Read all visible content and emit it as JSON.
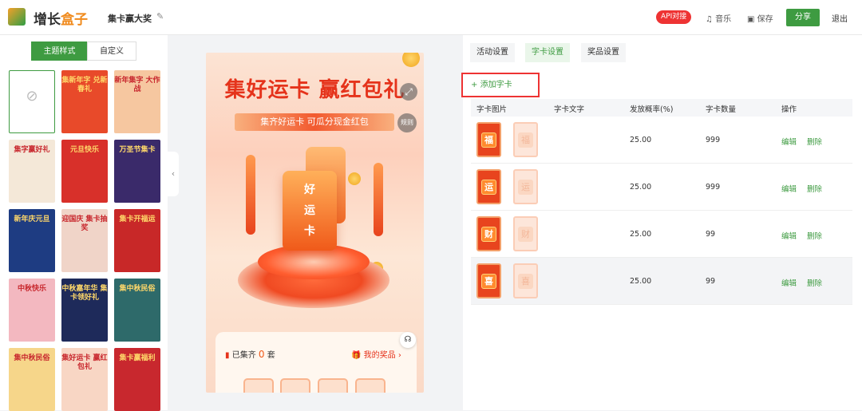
{
  "header": {
    "logo_text_a": "增长",
    "logo_text_b": "盒子",
    "activity_title": "集卡赢大奖",
    "api_badge": "API对接",
    "music": "音乐",
    "save": "保存",
    "share": "分享",
    "exit": "退出"
  },
  "left_panel": {
    "segments": [
      "主题样式",
      "自定义"
    ],
    "templates": [
      {
        "label": "",
        "bg": "empty"
      },
      {
        "label": "集新年字 兑新春礼",
        "bg": "#e84a2a"
      },
      {
        "label": "新年集字 大作战",
        "bg": "#f6c7a0"
      },
      {
        "label": "集字赢好礼",
        "bg": "#f4e8d8"
      },
      {
        "label": "元旦快乐",
        "bg": "#d8302a"
      },
      {
        "label": "万圣节集卡",
        "bg": "#3a2a6a"
      },
      {
        "label": "新年庆元旦",
        "bg": "#1e3c82"
      },
      {
        "label": "迎国庆 集卡抽奖",
        "bg": "#f0d4c8"
      },
      {
        "label": "集卡开福运",
        "bg": "#c82828"
      },
      {
        "label": "中秋快乐",
        "bg": "#f3b8c0"
      },
      {
        "label": "中秋嘉年华 集卡领好礼",
        "bg": "#1e2a5a"
      },
      {
        "label": "集中秋民俗",
        "bg": "#2e6a6a"
      },
      {
        "label": "集中秋民俗",
        "bg": "#f6d68a"
      },
      {
        "label": "集好运卡 赢红包礼",
        "bg": "#f8d6c4"
      },
      {
        "label": "集卡赢福利",
        "bg": "#c8282e"
      }
    ]
  },
  "preview": {
    "title": "集好运卡 赢红包礼",
    "subtitle": "集齐好运卡 可瓜分现金红包",
    "rule": "规则",
    "card_chars": [
      "好",
      "运",
      "卡"
    ],
    "collected_prefix": "已集齐",
    "collected_count": "0",
    "collected_suffix": "套",
    "my_prizes": "我的奖品"
  },
  "right_panel": {
    "tabs": [
      "活动设置",
      "字卡设置",
      "奖品设置"
    ],
    "add_card": "添加字卡",
    "columns": [
      "字卡图片",
      "字卡文字",
      "发放概率(%)",
      "字卡数量",
      "操作"
    ],
    "rows": [
      {
        "char": "福",
        "text": "",
        "probability": "25.00",
        "quantity": "999",
        "edit": "编辑",
        "delete": "删除"
      },
      {
        "char": "运",
        "text": "",
        "probability": "25.00",
        "quantity": "999",
        "edit": "编辑",
        "delete": "删除"
      },
      {
        "char": "财",
        "text": "",
        "probability": "25.00",
        "quantity": "99",
        "edit": "编辑",
        "delete": "删除"
      },
      {
        "char": "喜",
        "text": "",
        "probability": "25.00",
        "quantity": "99",
        "edit": "编辑",
        "delete": "删除"
      }
    ]
  },
  "colors": {
    "accent": "#3e9b41",
    "danger": "#e33333",
    "brand_orange": "#f08a1c"
  }
}
